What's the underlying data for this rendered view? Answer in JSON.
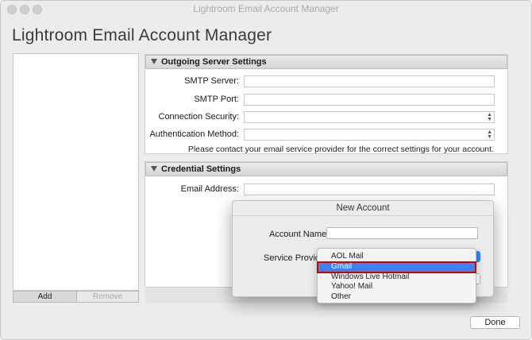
{
  "window": {
    "title": "Lightroom Email Account Manager"
  },
  "heading": "Lightroom Email Account Manager",
  "account_list": {
    "add_label": "Add",
    "remove_label": "Remove"
  },
  "outgoing": {
    "header": "Outgoing Server Settings",
    "smtp_server_label": "SMTP Server:",
    "smtp_port_label": "SMTP Port:",
    "connection_security_label": "Connection Security:",
    "authentication_method_label": "Authentication Method:",
    "note": "Please contact your email service provider for the correct settings for your account."
  },
  "credential": {
    "header": "Credential Settings",
    "email_address_label": "Email Address:"
  },
  "new_account": {
    "title": "New Account",
    "account_name_label": "Account Name:",
    "account_name_value": "",
    "service_provider_label": "Service Provider",
    "options": [
      "AOL Mail",
      "Gmail",
      "Windows Live Hotmail",
      "Yahoo! Mail",
      "Other"
    ],
    "selected": "Gmail"
  },
  "done_label": "Done",
  "colors": {
    "accent": "#3b82f6",
    "highlight_border": "#d10000"
  }
}
